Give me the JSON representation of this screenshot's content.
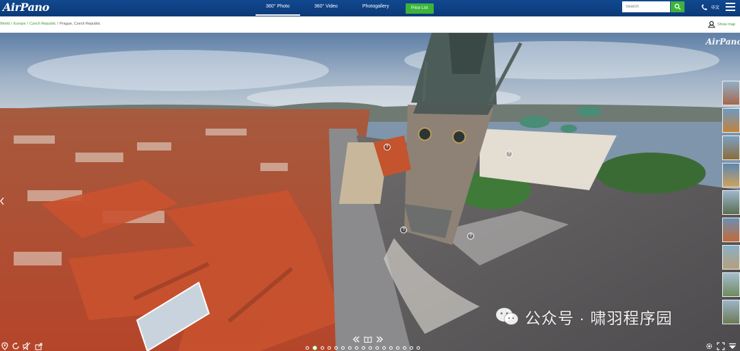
{
  "header": {
    "logo": "AirPano",
    "nav": [
      "360° Photo",
      "360° Video",
      "Photogallery"
    ],
    "price_list": "Price List",
    "search_placeholder": "Search",
    "language": "中文"
  },
  "breadcrumb": {
    "links": [
      "World",
      "Europe",
      "Czech Republic"
    ],
    "current": "Prague, Czech Republic",
    "show_map": "Show map"
  },
  "pano": {
    "watermark": "AirPano",
    "hotspot_mark": "?",
    "wechat_text": "公众号 · 啸羽程序园"
  },
  "colors": {
    "nav_bg": "#0b3a78",
    "accent_green": "#3cb43c",
    "link_green": "#3a9a2a"
  }
}
